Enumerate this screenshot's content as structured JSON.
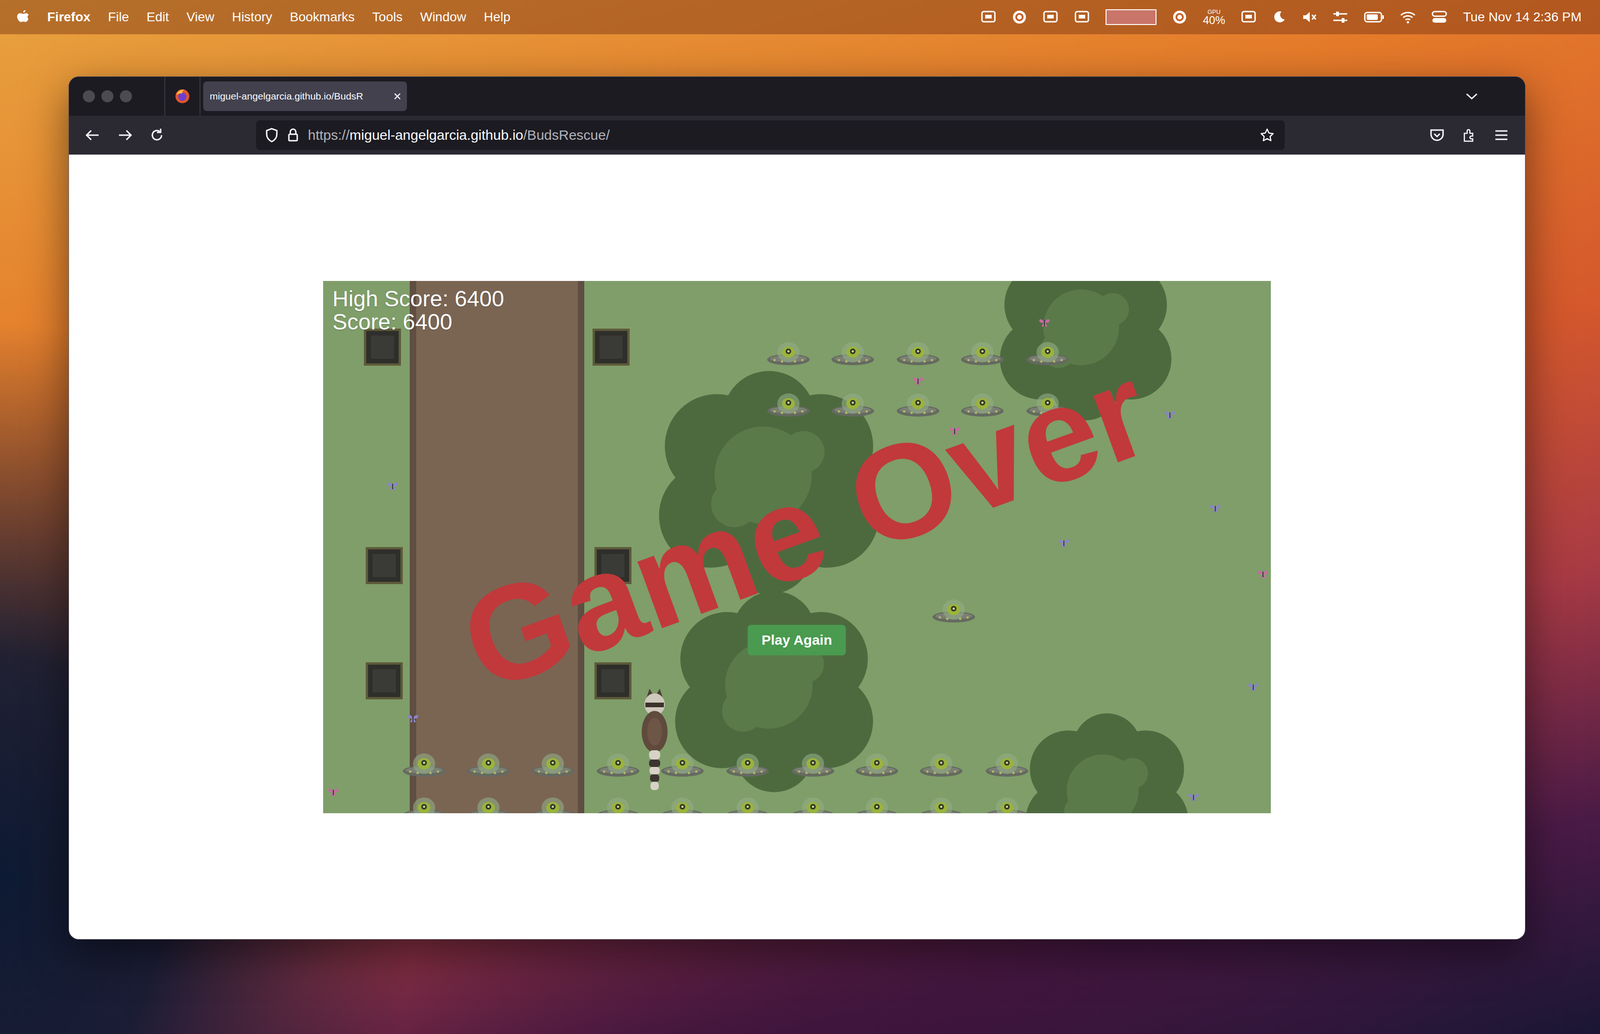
{
  "menu_bar": {
    "app": "Firefox",
    "items": [
      "File",
      "Edit",
      "View",
      "History",
      "Bookmarks",
      "Tools",
      "Window",
      "Help"
    ],
    "gpu_label": "GPU",
    "gpu_value": "40%",
    "clock": "Tue Nov 14 2:36 PM"
  },
  "browser": {
    "tabs": [
      {
        "label": "miguel-angelgarcia.github.io/BudsR",
        "close": "×",
        "selected": true
      }
    ],
    "url": {
      "scheme": "https://",
      "host": "miguel-angelgarcia.github.io",
      "path": "/BudsRescue/"
    }
  },
  "game": {
    "high_score": "High Score: 6400",
    "score": "Score: 6400",
    "title": "Game Over",
    "button": "Play Again"
  }
}
